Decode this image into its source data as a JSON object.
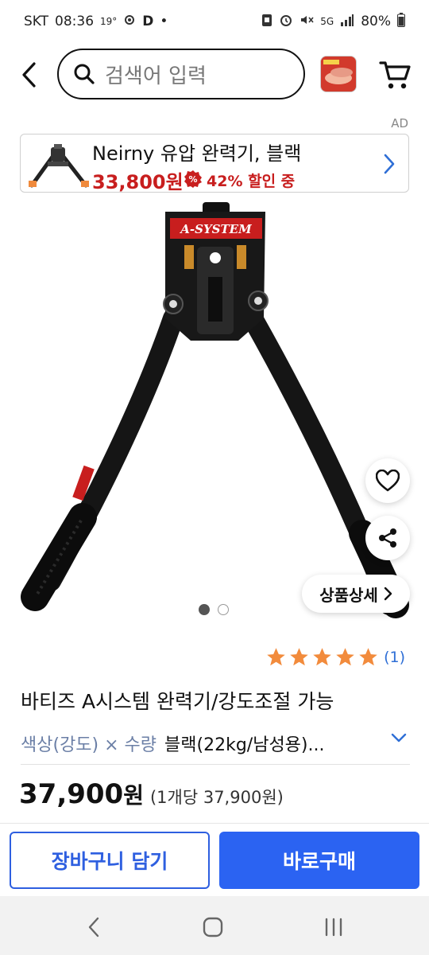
{
  "status_bar": {
    "carrier": "SKT",
    "time": "08:36",
    "temp": "19°",
    "network": "5G",
    "battery": "80%"
  },
  "search": {
    "placeholder": "검색어 입력"
  },
  "ad": {
    "label": "AD",
    "title": "Neirny 유압 완력기, 블랙",
    "price": "33,800원",
    "discount": "42% 할인 중"
  },
  "product": {
    "brand_mark": "A-SYSTEM",
    "detail_button": "상품상세",
    "image_count": 2,
    "active_image": 1,
    "rating": 5,
    "review_count": "(1)",
    "title": "바티즈 A시스템 완력기/강도조절 가능",
    "option_label": "색상(강도) × 수량",
    "option_value": "블랙(22kg/남성용)...",
    "price": "37,900",
    "price_won": "원",
    "unit_price": "(1개당 37,900원)"
  },
  "actions": {
    "add_to_cart": "장바구니 담기",
    "buy_now": "바로구매"
  },
  "colors": {
    "accent": "#2b63f2",
    "sale": "#c81e1e",
    "star": "#f28b3c"
  }
}
